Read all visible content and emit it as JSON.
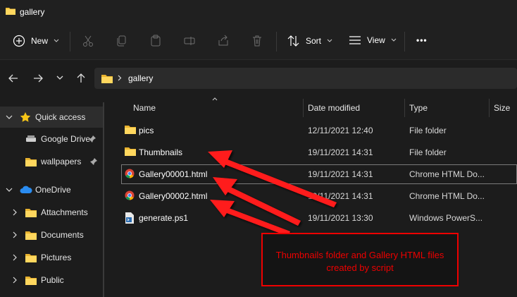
{
  "window": {
    "title": "gallery"
  },
  "toolbar": {
    "new_label": "New",
    "sort_label": "Sort",
    "view_label": "View",
    "more_label": "•••"
  },
  "address": {
    "folder": "gallery"
  },
  "sidebar": {
    "items": [
      {
        "label": "Quick access"
      },
      {
        "label": "Google Drive"
      },
      {
        "label": "wallpapers"
      },
      {
        "label": "OneDrive"
      },
      {
        "label": "Attachments"
      },
      {
        "label": "Documents"
      },
      {
        "label": "Pictures"
      },
      {
        "label": "Public"
      }
    ]
  },
  "columns": {
    "name": "Name",
    "date": "Date modified",
    "type": "Type",
    "size": "Size"
  },
  "files": [
    {
      "name": "pics",
      "date": "12/11/2021 12:40",
      "type": "File folder"
    },
    {
      "name": "Thumbnails",
      "date": "19/11/2021 14:31",
      "type": "File folder"
    },
    {
      "name": "Gallery00001.html",
      "date": "19/11/2021 14:31",
      "type": "Chrome HTML Do..."
    },
    {
      "name": "Gallery00002.html",
      "date": "19/11/2021 14:31",
      "type": "Chrome HTML Do..."
    },
    {
      "name": "generate.ps1",
      "date": "19/11/2021 13:30",
      "type": "Windows PowerS..."
    }
  ],
  "annotation": {
    "line1": "Thumbnails folder and Gallery HTML files",
    "line2": "created by script",
    "color": "#e00000"
  }
}
